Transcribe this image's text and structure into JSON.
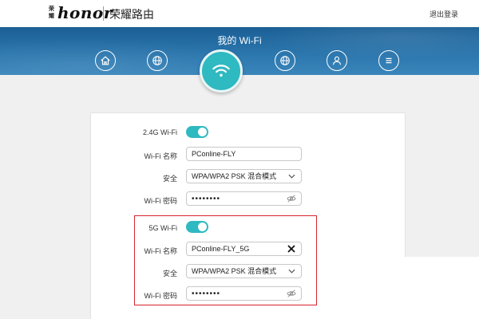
{
  "header": {
    "brand_small": "荣耀",
    "brand_logo": "honor",
    "app_title": "荣耀路由",
    "logout_label": "退出登录"
  },
  "banner": {
    "title": "我的 Wi-Fi",
    "nav_icons": [
      "home-icon",
      "globe-icon",
      "wifi-icon",
      "globe-icon",
      "user-icon",
      "menu-icon"
    ]
  },
  "wifi24": {
    "label": "2.4G Wi-Fi",
    "enabled": true,
    "name_label": "Wi-Fi 名称",
    "name_value": "PConline-FLY",
    "security_label": "安全",
    "security_value": "WPA/WPA2 PSK 混合模式",
    "password_label": "Wi-Fi 密码",
    "password_value": "••••••••"
  },
  "wifi5": {
    "label": "5G Wi-Fi",
    "enabled": true,
    "name_label": "Wi-Fi 名称",
    "name_value": "PConline-FLY_5G",
    "security_label": "安全",
    "security_value": "WPA/WPA2 PSK 混合模式",
    "password_label": "Wi-Fi 密码",
    "password_value": "••••••••"
  },
  "colors": {
    "accent": "#2fb9c1",
    "banner": "#1f6aa3",
    "highlight": "#d9232d"
  }
}
